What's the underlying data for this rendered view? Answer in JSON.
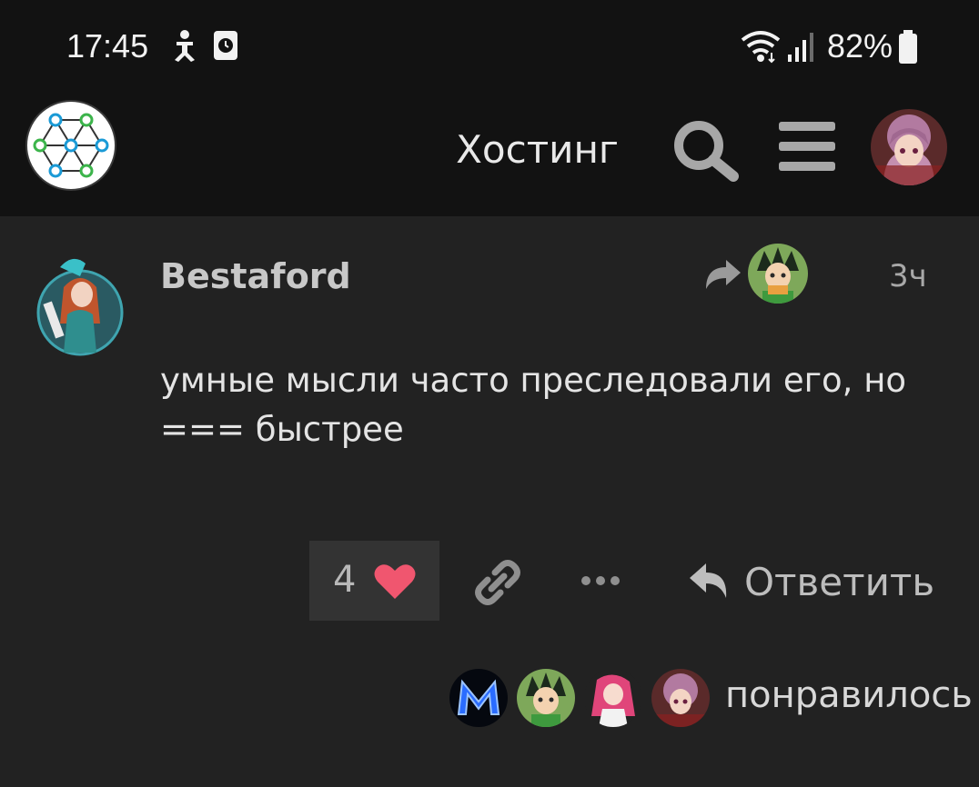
{
  "status_bar": {
    "time": "17:45",
    "battery": "82%",
    "icons": [
      "accessibility-icon",
      "screen-record-icon",
      "wifi-icon",
      "signal-icon",
      "battery-icon"
    ]
  },
  "header": {
    "title": "Хостинг",
    "logo": "network-hexagon-logo",
    "search_icon": "search-icon",
    "menu_icon": "hamburger-menu-icon"
  },
  "post": {
    "author": "Bestaford",
    "time": "3ч",
    "body_lines": [
      "умные мысли часто преследовали его, но",
      "=== быстрее"
    ]
  },
  "actions": {
    "like_count": "4",
    "reply_label": "Ответить",
    "colors": {
      "heart": "#f0566f",
      "like_bg": "#333333"
    }
  },
  "likers": {
    "label": "понравилось"
  },
  "colors": {
    "background": "#222222",
    "header_bg": "#121212",
    "text": "#e4e4e4",
    "muted": "#a8a8a8"
  }
}
